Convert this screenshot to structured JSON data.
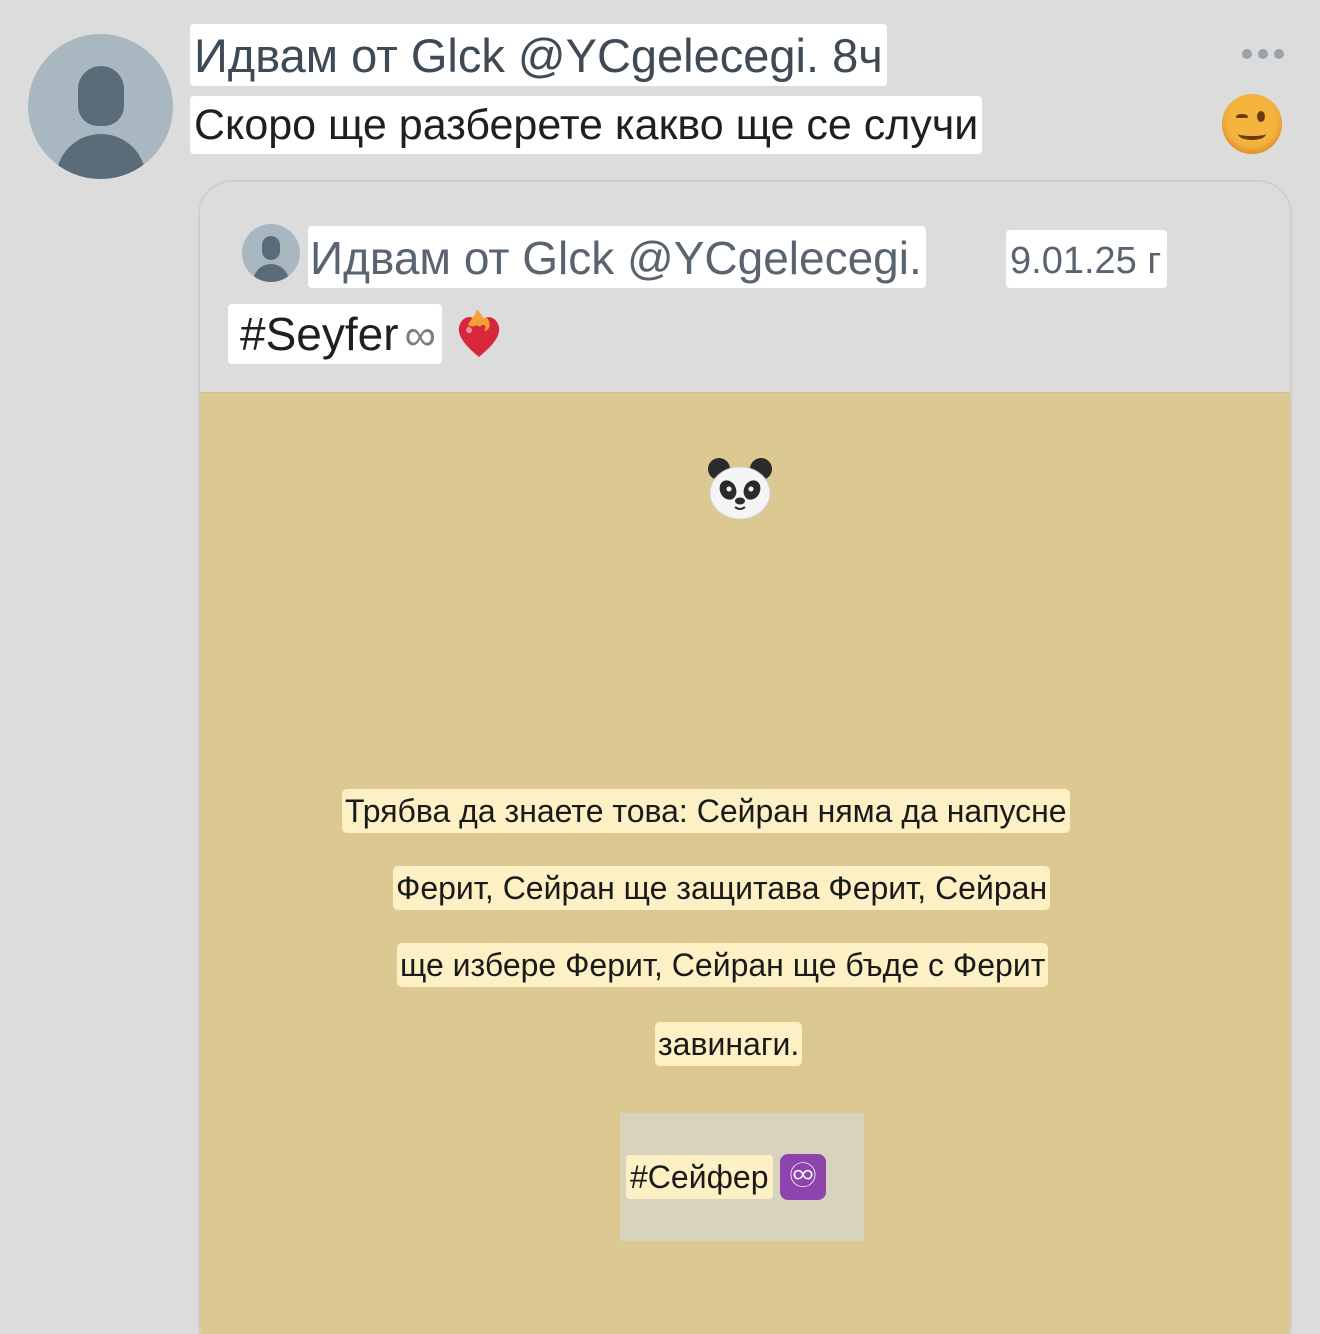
{
  "post": {
    "header": "Идвам от Glck @YCgelecegi. 8ч",
    "text": "Скоро ще разберете какво ще се случи",
    "text_emoji": "winking-face",
    "more_icon": "ellipsis-icon"
  },
  "quoted": {
    "name_handle": "Идвам от Glck @YCgelecegi.",
    "date": "9.01.25 г",
    "hashtag": "#Seyfer",
    "infinity": "∞",
    "heart_emoji": "heart-on-fire",
    "image": {
      "background": "#dcc991",
      "top_emoji": "panda-face",
      "lines": [
        "Трябва да знаете това: Сейран няма да напусне",
        "Ферит, Сейран ще защитава Ферит, Сейран",
        "ще избере Ферит, Сейран ще бъде с Ферит",
        "завинаги."
      ],
      "hashtag": "#Сейфер",
      "hashtag_symbol": "♾"
    }
  }
}
